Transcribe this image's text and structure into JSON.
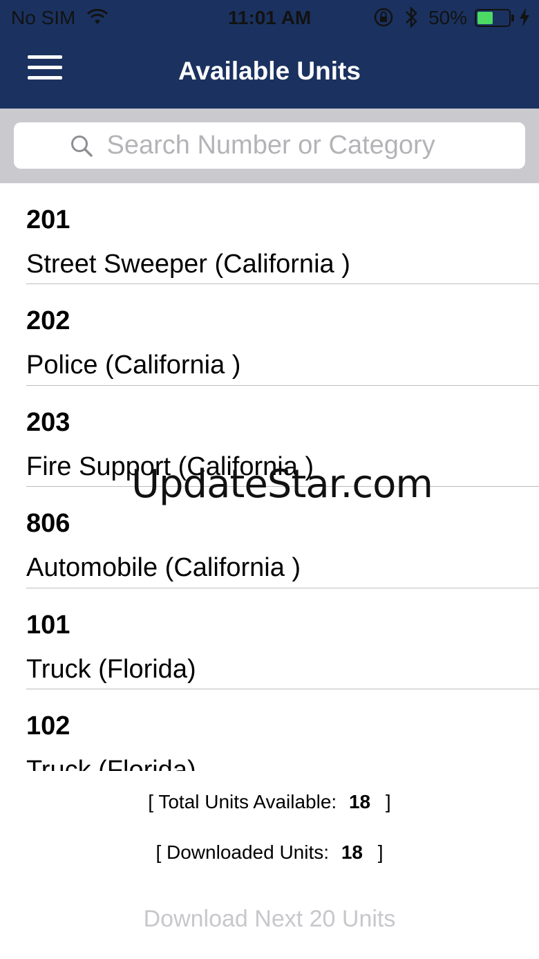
{
  "status_bar": {
    "carrier": "No SIM",
    "time": "11:01 AM",
    "battery_percent": "50%",
    "battery_level": 0.5,
    "icons": [
      "wifi-icon",
      "orientation-lock-icon",
      "bluetooth-icon",
      "battery-icon",
      "charging-icon"
    ]
  },
  "header": {
    "title": "Available Units",
    "menu_icon": "hamburger-menu-icon",
    "background": "#1b3260"
  },
  "search": {
    "placeholder": "Search Number or Category",
    "value": "",
    "icon": "search-icon"
  },
  "units": [
    {
      "number": "201",
      "category": "Street Sweeper (California )"
    },
    {
      "number": "202",
      "category": "Police (California )"
    },
    {
      "number": "203",
      "category": "Fire Support (California )"
    },
    {
      "number": "806",
      "category": "Automobile (California )"
    },
    {
      "number": "101",
      "category": "Truck (Florida)"
    },
    {
      "number": "102",
      "category": "Truck (Florida)"
    }
  ],
  "watermark": "UpdateStar.com",
  "summary": {
    "total_label": "Total Units Available:",
    "total_value": "18",
    "downloaded_label": "Downloaded Units:",
    "downloaded_value": "18",
    "open_bracket": "[",
    "close_bracket": "]"
  },
  "download_button": {
    "label": "Download Next 20 Units",
    "color": "#c7c7cc"
  }
}
